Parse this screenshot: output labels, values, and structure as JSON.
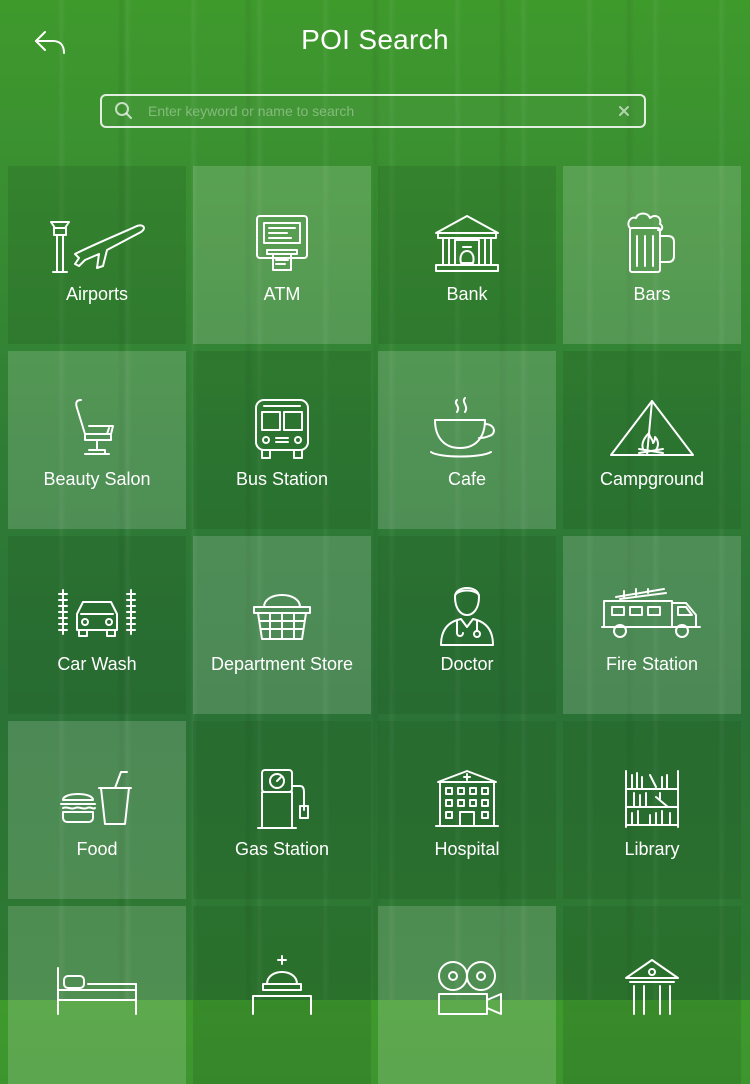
{
  "header": {
    "title": "POI Search"
  },
  "search": {
    "placeholder": "Enter keyword or name to search",
    "value": ""
  },
  "categories": [
    {
      "label": "Airports",
      "icon": "airport-icon"
    },
    {
      "label": "ATM",
      "icon": "atm-icon"
    },
    {
      "label": "Bank",
      "icon": "bank-icon"
    },
    {
      "label": "Bars",
      "icon": "beer-mug-icon"
    },
    {
      "label": "Beauty Salon",
      "icon": "salon-chair-icon"
    },
    {
      "label": "Bus Station",
      "icon": "bus-icon"
    },
    {
      "label": "Cafe",
      "icon": "coffee-cup-icon"
    },
    {
      "label": "Campground",
      "icon": "tent-campfire-icon"
    },
    {
      "label": "Car Wash",
      "icon": "car-wash-icon"
    },
    {
      "label": "Department Store",
      "icon": "shopping-basket-icon"
    },
    {
      "label": "Doctor",
      "icon": "doctor-icon"
    },
    {
      "label": "Fire Station",
      "icon": "fire-truck-icon"
    },
    {
      "label": "Food",
      "icon": "burger-drink-icon"
    },
    {
      "label": "Gas Station",
      "icon": "gas-pump-icon"
    },
    {
      "label": "Hospital",
      "icon": "hospital-building-icon"
    },
    {
      "label": "Library",
      "icon": "bookshelf-icon"
    },
    {
      "label": "",
      "icon": "bed-icon"
    },
    {
      "label": "",
      "icon": "capitol-building-icon"
    },
    {
      "label": "",
      "icon": "movie-camera-icon"
    },
    {
      "label": "",
      "icon": "museum-icon"
    }
  ],
  "colors": {
    "background_top": "#3f9a2c",
    "background_bottom": "#2a7236",
    "text": "#ffffff"
  }
}
